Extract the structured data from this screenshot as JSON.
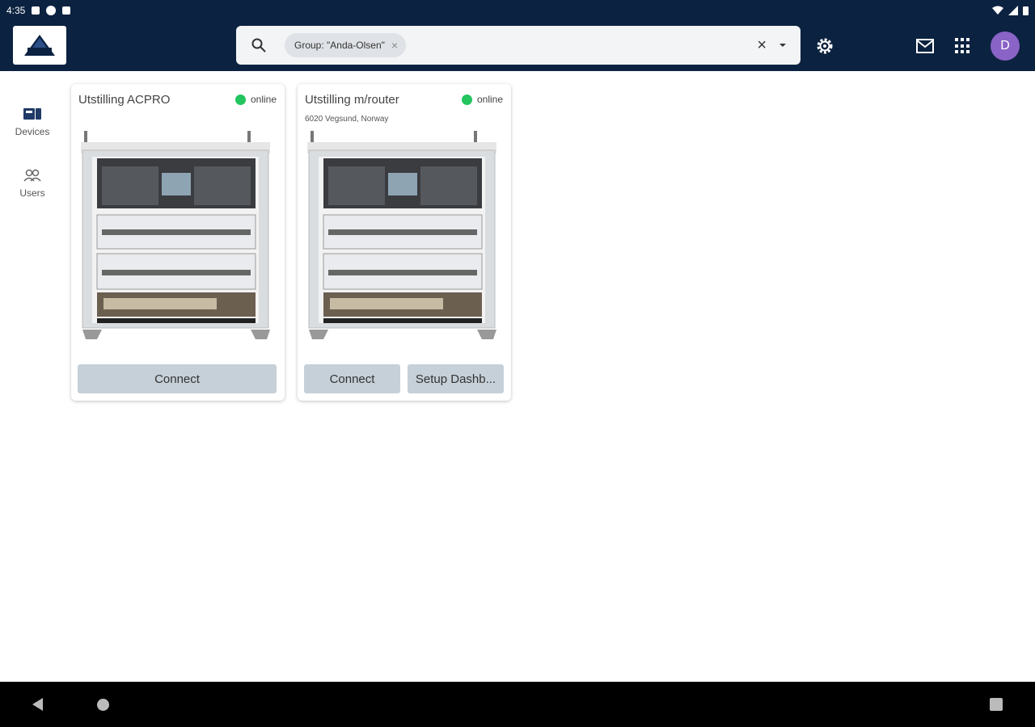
{
  "status_bar": {
    "time": "4:35"
  },
  "search": {
    "chip_label": "Group: \"Anda-Olsen\"",
    "chip_remove": "×",
    "clear": "×"
  },
  "user": {
    "avatar_letter": "D"
  },
  "colors": {
    "header": "#0b2240",
    "online": "#22c55e",
    "avatar": "#8a63c7",
    "button": "#c6d0d8"
  },
  "sidebar": {
    "items": [
      {
        "label": "Devices",
        "icon": "devices-icon"
      },
      {
        "label": "Users",
        "icon": "users-icon"
      }
    ]
  },
  "devices": [
    {
      "name": "Utstilling ACPRO",
      "status": "online",
      "address": "",
      "buttons": [
        "Connect"
      ]
    },
    {
      "name": "Utstilling m/router",
      "status": "online",
      "address": "6020 Vegsund, Norway",
      "buttons": [
        "Connect",
        "Setup Dashb..."
      ]
    }
  ]
}
